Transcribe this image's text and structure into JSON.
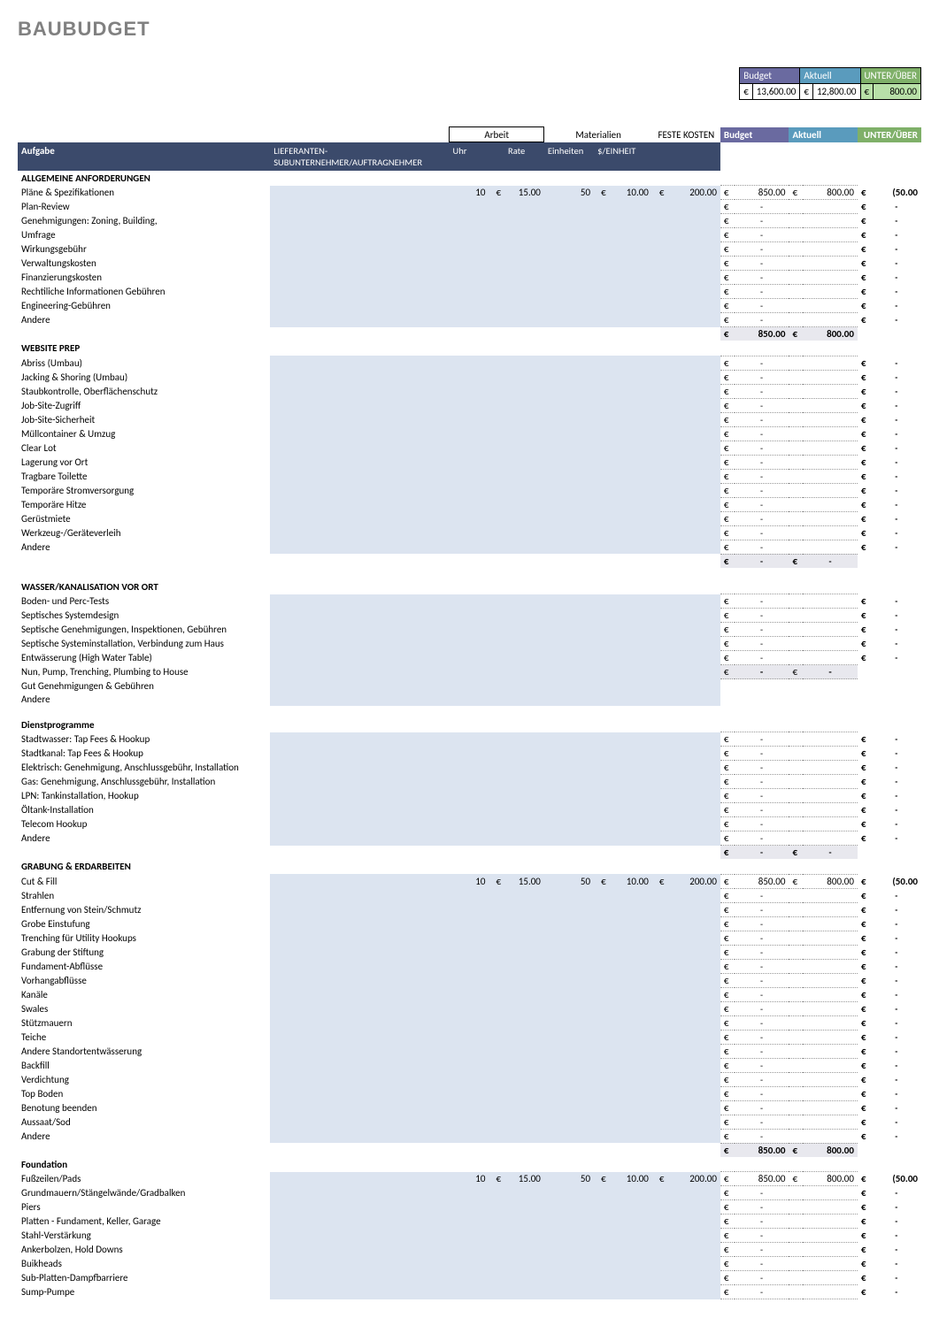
{
  "title": "BAUBUDGET",
  "summary": {
    "headers": {
      "budget": "Budget",
      "aktuell": "Aktuell",
      "unter": "UNTER/ÜBER"
    },
    "values": {
      "budget": "13,600.00",
      "aktuell": "12,800.00",
      "unter": "800.00"
    }
  },
  "group_headers": {
    "arbeit": "Arbeit",
    "materialien": "Materialien",
    "feste": "FESTE KOSTEN"
  },
  "col_headers": {
    "aufgabe": "Aufgabe",
    "lieferanten": "LIEFERANTEN-SUBUNTERNEHMER/AUFTRAGNEHMER",
    "uhr": "Uhr",
    "rate": "Rate",
    "einheiten": "Einheiten",
    "per_unit": "$/EINHEIT",
    "budget": "Budget",
    "aktuell": "Aktuell",
    "unter": "UNTER/ÜBER"
  },
  "currency": "€",
  "sections": [
    {
      "name": "ALLGEMEINE ANFORDERUNGEN",
      "rows": [
        {
          "task": "Pläne & Spezifikationen",
          "hrs": "10",
          "rate": "15.00",
          "units": "50",
          "per": "10.00",
          "fixed": "200.00",
          "budget": "850.00",
          "aktuell": "800.00",
          "unter": "(50.00"
        },
        {
          "task": "Plan-Review",
          "budget": "-",
          "unter": "-"
        },
        {
          "task": "Genehmigungen: Zoning, Building,",
          "budget": "-",
          "unter": "-"
        },
        {
          "task": "Umfrage",
          "budget": "-",
          "unter": "-"
        },
        {
          "task": "Wirkungsgebühr",
          "budget": "-",
          "unter": "-"
        },
        {
          "task": "Verwaltungskosten",
          "budget": "-",
          "unter": "-"
        },
        {
          "task": "Finanzierungskosten",
          "budget": "-",
          "unter": "-"
        },
        {
          "task": "Rechtiliche Informationen Gebühren",
          "budget": "-",
          "unter": "-"
        },
        {
          "task": "Engineering-Gebühren",
          "budget": "-",
          "unter": "-"
        },
        {
          "task": "Andere",
          "budget": "-",
          "unter": "-"
        }
      ],
      "subtotal": {
        "budget": "850.00",
        "aktuell": "800.00"
      }
    },
    {
      "name": "WEBSITE PREP",
      "rows": [
        {
          "task": "Abriss (Umbau)",
          "budget": "-",
          "unter": "-"
        },
        {
          "task": "Jacking & Shoring (Umbau)",
          "budget": "-",
          "unter": "-"
        },
        {
          "task": "Staubkontrolle, Oberflächenschutz",
          "budget": "-",
          "unter": "-"
        },
        {
          "task": "Job-Site-Zugriff",
          "budget": "-",
          "unter": "-"
        },
        {
          "task": "Job-Site-Sicherheit",
          "budget": "-",
          "unter": "-"
        },
        {
          "task": "Müllcontainer & Umzug",
          "budget": "-",
          "unter": "-"
        },
        {
          "task": "Clear Lot",
          "budget": "-",
          "unter": "-"
        },
        {
          "task": "Lagerung vor Ort",
          "budget": "-",
          "unter": "-"
        },
        {
          "task": "Tragbare Toilette",
          "budget": "-",
          "unter": "-"
        },
        {
          "task": "Temporäre Stromversorgung",
          "budget": "-",
          "unter": "-"
        },
        {
          "task": "Temporäre Hitze",
          "budget": "-",
          "unter": "-"
        },
        {
          "task": "Gerüstmiete",
          "budget": "-",
          "unter": "-"
        },
        {
          "task": "Werkzeug-/Geräteverleih",
          "budget": "-",
          "unter": "-"
        },
        {
          "task": "Andere",
          "budget": "-",
          "unter": "-"
        }
      ],
      "subtotal": {
        "budget": "-",
        "aktuell": "-"
      }
    },
    {
      "name": "WASSER/KANALISATION VOR ORT",
      "pre_blank": true,
      "rows": [
        {
          "task": "Boden- und Perc-Tests",
          "budget": "-",
          "unter": "-"
        },
        {
          "task": "Septisches Systemdesign",
          "budget": "-",
          "unter": "-"
        },
        {
          "task": "Septische Genehmigungen, Inspektionen, Gebühren",
          "budget": "-",
          "unter": "-"
        },
        {
          "task": "Septische Systeminstallation, Verbindung zum Haus",
          "budget": "-",
          "unter": "-"
        },
        {
          "task": "Entwässerung (High Water Table)",
          "budget": "-",
          "unter": "-"
        },
        {
          "task": "Nun, Pump, Trenching, Plumbing to House",
          "subtotal_row": true,
          "budget": "-",
          "aktuell": "-"
        },
        {
          "task": "Gut Genehmigungen & Gebühren",
          "no_money": true
        },
        {
          "task": "Andere",
          "no_money": true
        }
      ]
    },
    {
      "name": "Dienstprogramme",
      "pre_blank": true,
      "rows": [
        {
          "task": "Stadtwasser: Tap Fees & Hookup",
          "budget": "-",
          "unter": "-"
        },
        {
          "task": "Stadtkanal: Tap Fees & Hookup",
          "budget": "-",
          "unter": "-"
        },
        {
          "task": "Elektrisch: Genehmigung, Anschlussgebühr, Installation",
          "budget": "-",
          "unter": "-"
        },
        {
          "task": "Gas: Genehmigung, Anschlussgebühr, Installation",
          "budget": "-",
          "unter": "-"
        },
        {
          "task": "LPN: Tankinstallation, Hookup",
          "budget": "-",
          "unter": "-"
        },
        {
          "task": "Öltank-Installation",
          "budget": "-",
          "unter": "-"
        },
        {
          "task": "Telecom Hookup",
          "budget": "-",
          "unter": "-"
        },
        {
          "task": "Andere",
          "budget": "-",
          "unter": "-"
        }
      ],
      "subtotal": {
        "budget": "-",
        "aktuell": "-"
      }
    },
    {
      "name": "GRABUNG & ERDARBEITEN",
      "rows": [
        {
          "task": "Cut & Fill",
          "hrs": "10",
          "rate": "15.00",
          "units": "50",
          "per": "10.00",
          "fixed": "200.00",
          "budget": "850.00",
          "aktuell": "800.00",
          "unter": "(50.00"
        },
        {
          "task": "Strahlen",
          "budget": "-",
          "unter": "-"
        },
        {
          "task": "Entfernung von Stein/Schmutz",
          "budget": "-",
          "unter": "-"
        },
        {
          "task": "Grobe Einstufung",
          "budget": "-",
          "unter": "-"
        },
        {
          "task": "Trenching für Utility Hookups",
          "budget": "-",
          "unter": "-"
        },
        {
          "task": "Grabung der Stiftung",
          "budget": "-",
          "unter": "-"
        },
        {
          "task": "Fundament-Abflüsse",
          "budget": "-",
          "unter": "-"
        },
        {
          "task": "Vorhangabflüsse",
          "budget": "-",
          "unter": "-"
        },
        {
          "task": "Kanäle",
          "budget": "-",
          "unter": "-"
        },
        {
          "task": "Swales",
          "budget": "-",
          "unter": "-"
        },
        {
          "task": "Stützmauern",
          "budget": "-",
          "unter": "-"
        },
        {
          "task": "Teiche",
          "budget": "-",
          "unter": "-"
        },
        {
          "task": "Andere Standortentwässerung",
          "budget": "-",
          "unter": "-"
        },
        {
          "task": "Backfill",
          "budget": "-",
          "unter": "-"
        },
        {
          "task": "Verdichtung",
          "budget": "-",
          "unter": "-"
        },
        {
          "task": "Top Boden",
          "budget": "-",
          "unter": "-"
        },
        {
          "task": "Benotung beenden",
          "budget": "-",
          "unter": "-"
        },
        {
          "task": "Aussaat/Sod",
          "budget": "-",
          "unter": "-"
        },
        {
          "task": "Andere",
          "budget": "-",
          "unter": "-"
        }
      ],
      "subtotal": {
        "budget": "850.00",
        "aktuell": "800.00"
      }
    },
    {
      "name": "Foundation",
      "rows": [
        {
          "task": "Fußzeilen/Pads",
          "hrs": "10",
          "rate": "15.00",
          "units": "50",
          "per": "10.00",
          "fixed": "200.00",
          "budget": "850.00",
          "aktuell": "800.00",
          "unter": "(50.00"
        },
        {
          "task": "Grundmauern/Stängelwände/Gradbalken",
          "budget": "-",
          "unter": "-"
        },
        {
          "task": "Piers",
          "budget": "-",
          "unter": "-"
        },
        {
          "task": "Platten - Fundament, Keller, Garage",
          "budget": "-",
          "unter": "-"
        },
        {
          "task": "Stahl-Verstärkung",
          "budget": "-",
          "unter": "-"
        },
        {
          "task": "Ankerbolzen, Hold Downs",
          "budget": "-",
          "unter": "-"
        },
        {
          "task": "Buikheads",
          "budget": "-",
          "unter": "-"
        },
        {
          "task": "Sub-Platten-Dampfbarriere",
          "budget": "-",
          "unter": "-"
        },
        {
          "task": "Sump-Pumpe",
          "budget": "-",
          "unter": "-"
        }
      ]
    }
  ]
}
